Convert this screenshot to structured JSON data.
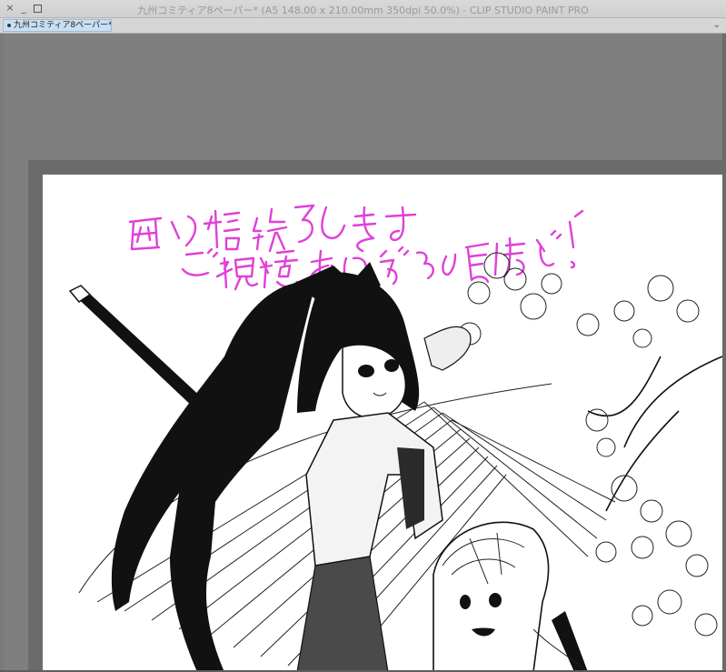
{
  "window": {
    "title": "九州コミティア8ペーパー* (A5 148.00 x 210.00mm 350dpi 50.0%)  - CLIP STUDIO PAINT PRO",
    "close_glyph": "×",
    "minimize_glyph": "_"
  },
  "tabs": [
    {
      "label": "九州コミティア8ペーパー*",
      "active": true
    }
  ],
  "tab_menu_glyph": "⌄",
  "canvas": {
    "background": "#ffffff",
    "handwritten_message_lines": [
      "配信終了します",
      "ご視聴ありがとうございました!"
    ],
    "message_color": "#e040d8",
    "illustration": "black-and-white manga illustration"
  }
}
